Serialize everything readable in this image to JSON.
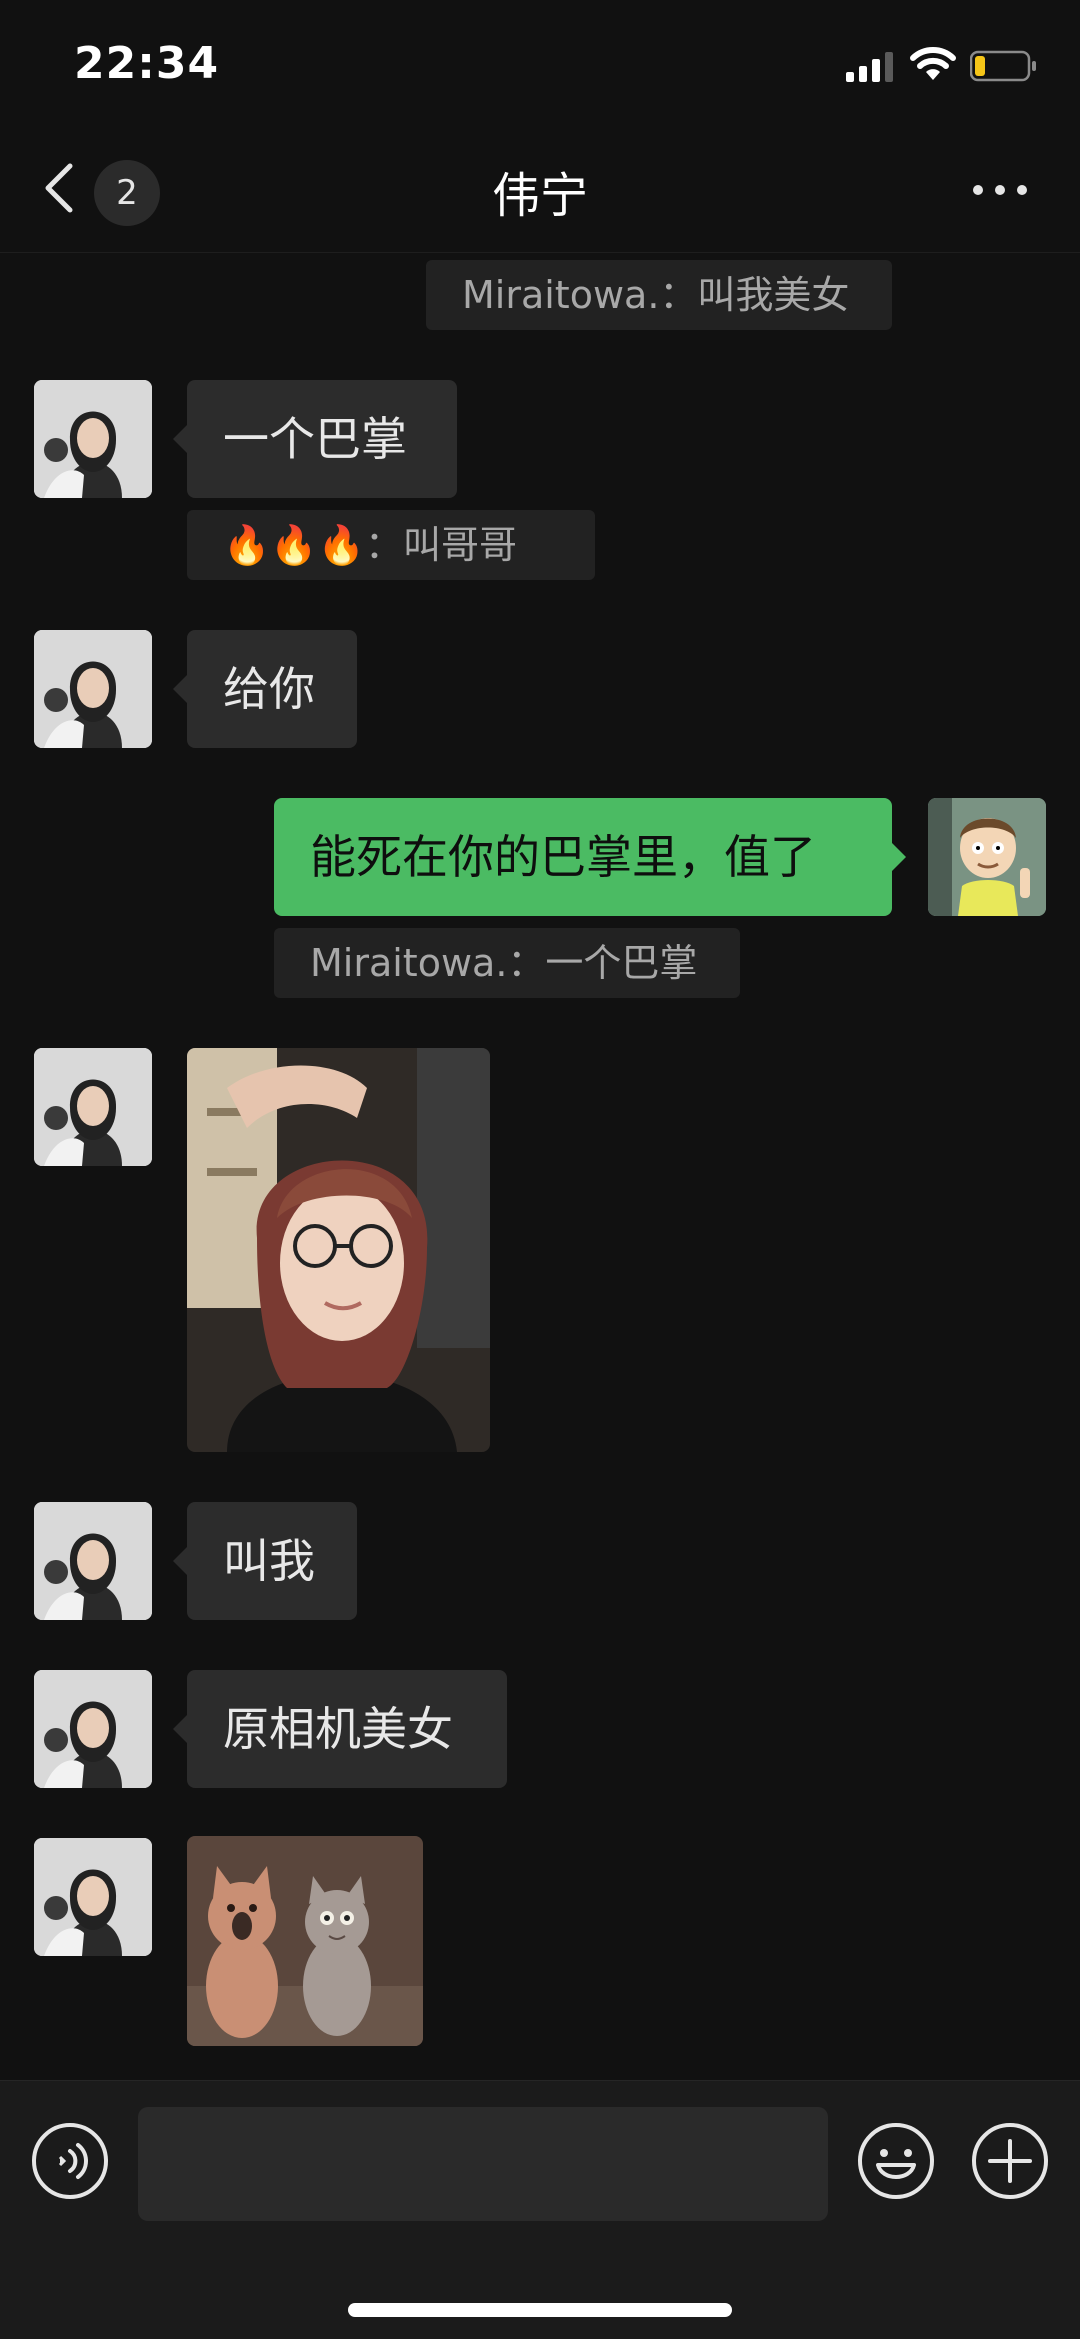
{
  "status_bar": {
    "time": "22:34"
  },
  "nav": {
    "unread_count": "2",
    "title": "伟宁"
  },
  "messages": [
    {
      "type": "quote",
      "text": "Miraitowa.：叫我美女"
    },
    {
      "type": "text",
      "side": "in",
      "text": "一个巴掌"
    },
    {
      "type": "quote",
      "text": "🔥🔥🔥：叫哥哥"
    },
    {
      "type": "text",
      "side": "in",
      "text": "给你"
    },
    {
      "type": "text",
      "side": "out",
      "text": "能死在你的巴掌里，值了"
    },
    {
      "type": "quote",
      "text": "Miraitowa.：一个巴掌"
    },
    {
      "type": "image",
      "side": "in",
      "content": "selfie-photo"
    },
    {
      "type": "text",
      "side": "in",
      "text": "叫我"
    },
    {
      "type": "text",
      "side": "in",
      "text": "原相机美女"
    },
    {
      "type": "sticker",
      "side": "in",
      "content": "cats-sticker"
    }
  ],
  "input": {
    "placeholder": ""
  },
  "icons": {
    "back": "chevron-left-icon",
    "more": "more-dots-icon",
    "voice": "voice-icon",
    "emoji": "emoji-icon",
    "plus": "plus-icon"
  },
  "colors": {
    "background": "#111111",
    "outgoing_bubble": "#4bbb63",
    "incoming_bubble": "#2c2c2c",
    "battery_level": "#f5c518"
  },
  "battery_level": 0.2
}
